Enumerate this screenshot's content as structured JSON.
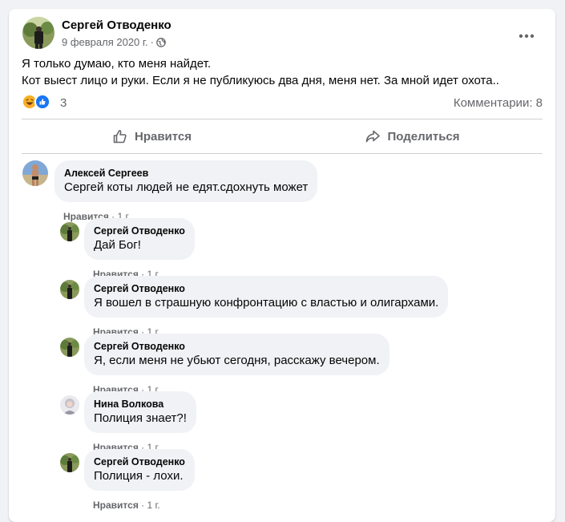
{
  "post": {
    "author": "Сергей Отводенко",
    "date": "9 февраля 2020 г.",
    "dot": "·",
    "privacy_icon": "globe-icon",
    "lines": [
      "Я только думаю, кто меня найдет.",
      "Кот выест лицо и руки. Если я не публикуюсь два дня, меня нет. За мной идет охота.."
    ],
    "reactions": [
      "haha",
      "like"
    ],
    "reaction_count": "3",
    "comments_count": "Комментарии: 8"
  },
  "actions": {
    "like": "Нравится",
    "share": "Поделиться"
  },
  "colors": {
    "bubble": "#f0f2f5",
    "secondary": "#65676b",
    "like_blue": "#1877f2",
    "haha_yellow": "#f7b125"
  },
  "comments": [
    {
      "author": "Алексей Сергеев",
      "text": "Сергей коты людей не едят.сдохнуть может",
      "like": "Нравится",
      "time": "1 г."
    },
    {
      "author": "Сергей Отводенко",
      "text": "Дай Бог!",
      "like": "Нравится",
      "time": "1 г."
    },
    {
      "author": "Сергей Отводенко",
      "text": "Я вошел в страшную конфронтацию с властью и олигархами.",
      "like": "Нравится",
      "time": "1 г."
    },
    {
      "author": "Сергей Отводенко",
      "text": "Я, если меня не убьют сегодня, расскажу вечером.",
      "like": "Нравится",
      "time": "1 г."
    },
    {
      "author": "Нина Волкова",
      "text": "Полиция знает?!",
      "like": "Нравится",
      "time": "1 г."
    },
    {
      "author": "Сергей Отводенко",
      "text": "Полиция - лохи.",
      "like": "Нравится",
      "time": "1 г."
    }
  ]
}
